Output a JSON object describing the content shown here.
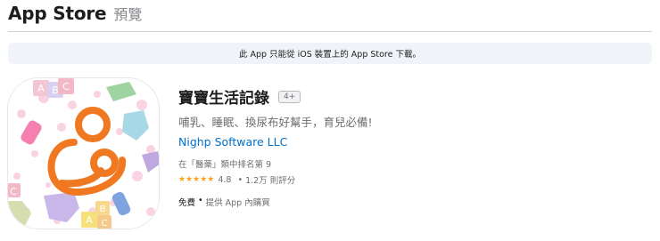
{
  "header": {
    "brand": "App Store",
    "preview": "預覽"
  },
  "banner": {
    "text": "此 App 只能從 iOS 裝置上的 App Store 下載。"
  },
  "app": {
    "title": "寶寶生活記錄",
    "age_rating": "4+",
    "subtitle": "哺乳、睡眠、換尿布好幫手，育兒必備!",
    "developer": "Nighp Software LLC",
    "rank": "在「醫藥」類中排名第 9",
    "stars": "★★★★★",
    "rating": "4.8",
    "separator": "•",
    "rating_count": "1.2万 則評分",
    "price": "免費",
    "iap": "提供 App 內購買",
    "icon_letters": [
      "A",
      "B",
      "C",
      "C",
      "A",
      "B",
      "C"
    ]
  },
  "colors": {
    "accent_link": "#0070c9",
    "star": "#f5a623",
    "banner_bg": "#f0f4f8",
    "icon_logo": "#f07820"
  }
}
